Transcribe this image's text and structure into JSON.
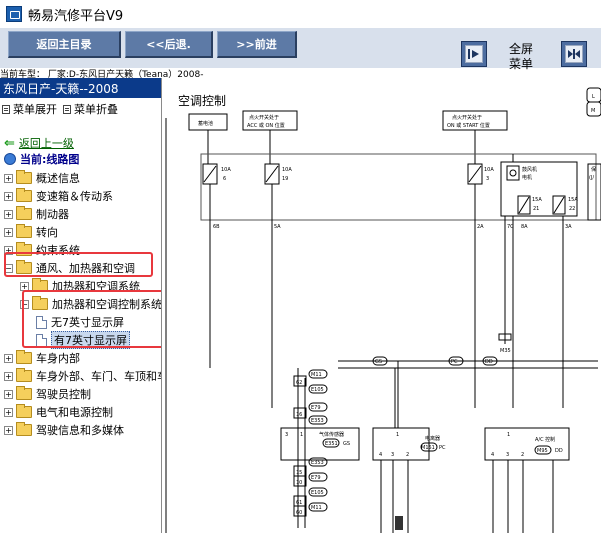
{
  "window": {
    "title": "畅易汽修平台V9"
  },
  "toolbar": {
    "home_label": "返回主目录",
    "back_label": "<<后退.",
    "forward_label": ">>前进",
    "fullscreen_label": "全屏",
    "menu_label": "菜单"
  },
  "vehicle_line": "当前车型： 厂家:D-东风日产天籁（Teana）2008-",
  "sidebar": {
    "model": "东风日产-天籁--2008",
    "expand_label": "菜单展开",
    "collapse_label": "菜单折叠",
    "back_link": "返回上一级",
    "current_label": "当前:线路图",
    "tree": [
      {
        "label": "概述信息",
        "level": 0,
        "expander": "+"
      },
      {
        "label": "变速箱＆传动系",
        "level": 0,
        "expander": "+"
      },
      {
        "label": "制动器",
        "level": 0,
        "expander": "+"
      },
      {
        "label": "转向",
        "level": 0,
        "expander": "+"
      },
      {
        "label": "约束系统",
        "level": 0,
        "expander": "+"
      },
      {
        "label": "通风、加热器和空调",
        "level": 0,
        "expander": "−"
      },
      {
        "label": "加热器和空调系统",
        "level": 1,
        "expander": "+"
      },
      {
        "label": "加热器和空调控制系统",
        "level": 1,
        "expander": "−"
      },
      {
        "label": "无7英寸显示屏",
        "level": 2,
        "expander": ""
      },
      {
        "label": "有7英寸显示屏",
        "level": 2,
        "expander": ""
      },
      {
        "label": "车身内部",
        "level": 0,
        "expander": "+"
      },
      {
        "label": "车身外部、车门、车顶和车",
        "level": 0,
        "expander": "+"
      },
      {
        "label": "驾驶员控制",
        "level": 0,
        "expander": "+"
      },
      {
        "label": "电气和电源控制",
        "level": 0,
        "expander": "+"
      },
      {
        "label": "驾驶信息和多媒体",
        "level": 0,
        "expander": "+"
      }
    ]
  },
  "diagram": {
    "title": "空调控制",
    "battery": "蓄电池",
    "ign_acc_line1": "点火开关处于",
    "ign_acc_line2": "ACC 或 ON 位置",
    "ign_start_line1": "点火开关处于",
    "ign_start_line2": "ON 或 START 位置",
    "fuse1": "10A",
    "fuse1_no": "6",
    "fuse2": "10A",
    "fuse2_no": "19",
    "fuse3": "10A",
    "fuse3_no": "3",
    "fuse4": "15A",
    "fuse4_no": "21",
    "fuse5": "15A",
    "fuse5_no": "22",
    "fan_motor_1": "鼓风机",
    "fan_motor_2": "电机",
    "prot_1": "保",
    "prot_2": "(J/",
    "wire_6b": "6B",
    "wire_5a": "5A",
    "wire_2a": "2A",
    "wire_7c": "7C",
    "wire_8a": "8A",
    "wire_3a": "3A",
    "m35": "M35",
    "gs": "GS",
    "pc": "PC",
    "dd": "DD",
    "m11": "M11",
    "n62": "62",
    "e105": "E105",
    "e79": "E79",
    "n16": "16",
    "e353": "E353",
    "n3": "3",
    "n1": "1",
    "sensor_label": "气体传感器",
    "e351": "E351",
    "gs2": "GS",
    "e353b": "E353",
    "n15": "15",
    "n10": "10",
    "e79b": "E79",
    "e105b": "E105",
    "n61": "61",
    "n60": "60",
    "m11b": "M11",
    "condenser_label": "电离器",
    "m151": "M151",
    "pc2": "PC",
    "ac_ctrl_label": "A/C 控制",
    "m95": "M95",
    "dd2": "DD",
    "n4": "4",
    "n2": "2",
    "nl": "L",
    "nm": "M"
  }
}
